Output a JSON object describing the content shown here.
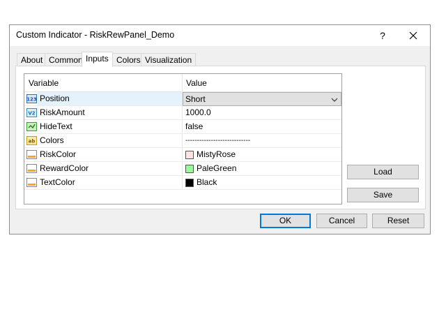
{
  "window": {
    "title": "Custom Indicator - RiskRewPanel_Demo",
    "help_glyph": "?"
  },
  "tabs": [
    {
      "label": "About"
    },
    {
      "label": "Common"
    },
    {
      "label": "Inputs"
    },
    {
      "label": "Colors"
    },
    {
      "label": "Visualization"
    }
  ],
  "active_tab": "Inputs",
  "grid": {
    "headers": {
      "variable": "Variable",
      "value": "Value"
    },
    "rows": [
      {
        "icon": "int-icon",
        "icon_text": "123",
        "variable": "Position",
        "value": "Short",
        "type": "dropdown"
      },
      {
        "icon": "double-icon",
        "icon_text": "V2",
        "variable": "RiskAmount",
        "value": "1000.0"
      },
      {
        "icon": "bool-icon",
        "icon_text": "",
        "variable": "HideText",
        "value": "false"
      },
      {
        "icon": "string-icon",
        "icon_text": "ab",
        "variable": "Colors",
        "value": "----------------------------"
      },
      {
        "icon": "color-icon",
        "icon_text": "",
        "variable": "RiskColor",
        "value": "MistyRose",
        "swatch": "#ffe4e1"
      },
      {
        "icon": "color-icon",
        "icon_text": "",
        "variable": "RewardColor",
        "value": "PaleGreen",
        "swatch": "#98fb98"
      },
      {
        "icon": "color-icon",
        "icon_text": "",
        "variable": "TextColor",
        "value": "Black",
        "swatch": "#000000"
      }
    ]
  },
  "side_buttons": {
    "load": "Load",
    "save": "Save"
  },
  "footer_buttons": {
    "ok": "OK",
    "cancel": "Cancel",
    "reset": "Reset"
  },
  "colors": {
    "accent": "#0078d7",
    "selected_row": "#e5f1fb"
  }
}
